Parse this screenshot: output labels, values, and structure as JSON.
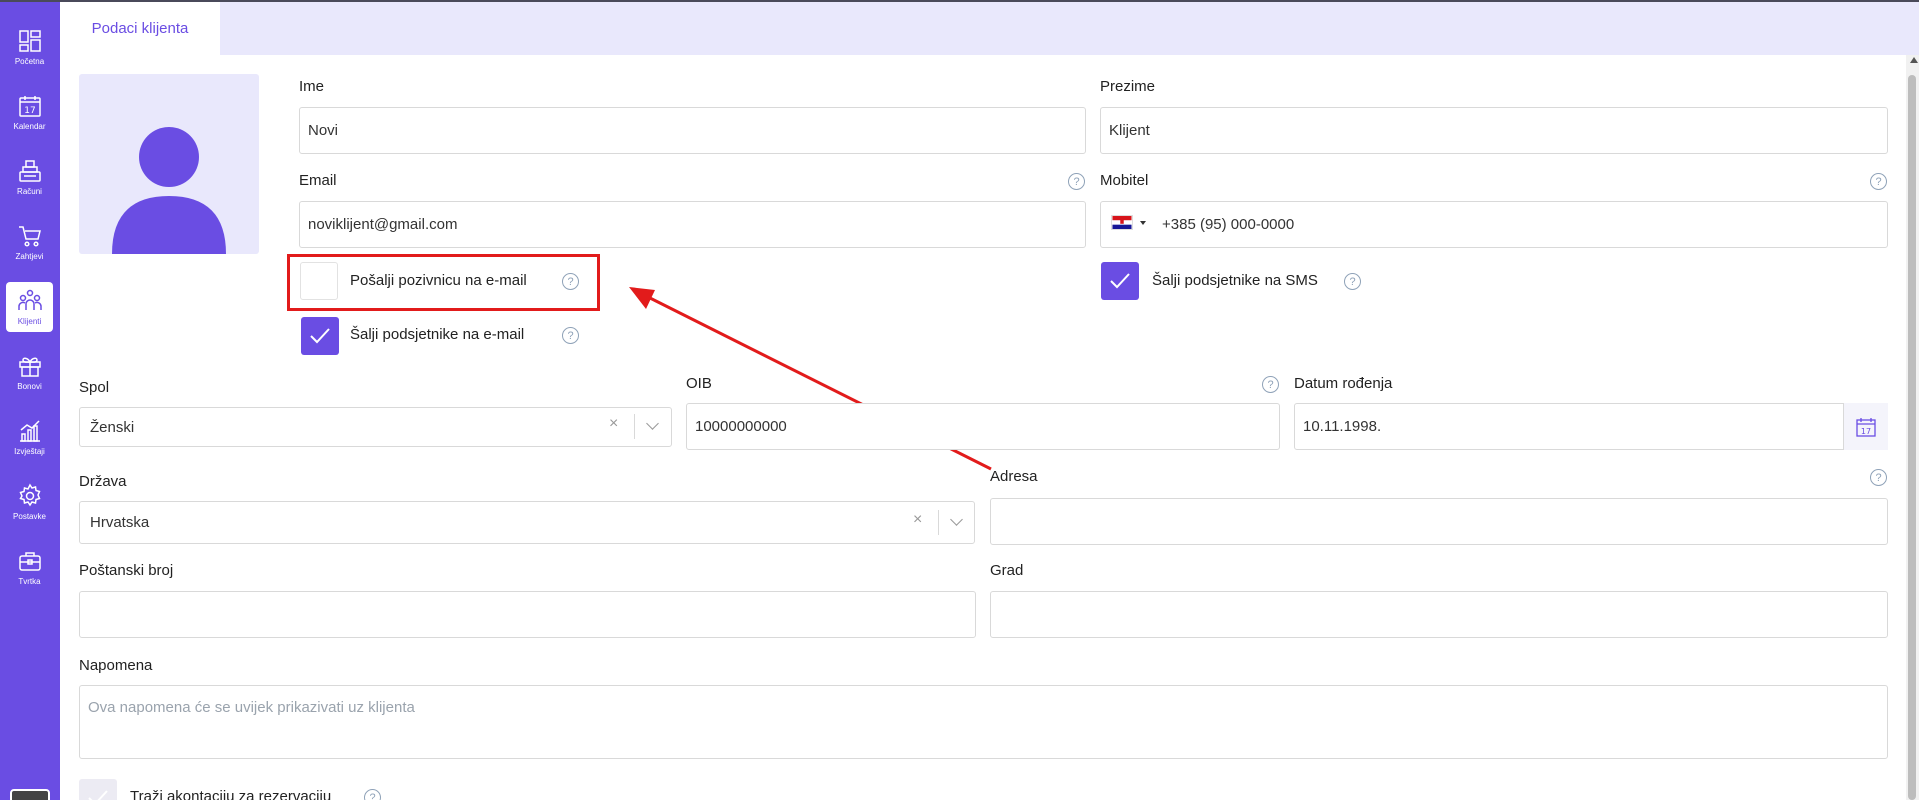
{
  "sidebar": {
    "items": [
      {
        "label": "Početna",
        "icon": "dashboard-icon"
      },
      {
        "label": "Kalendar",
        "icon": "calendar-icon"
      },
      {
        "label": "Računi",
        "icon": "cash-register-icon"
      },
      {
        "label": "Zahtjevi",
        "icon": "cart-icon"
      },
      {
        "label": "Klijenti",
        "icon": "clients-icon"
      },
      {
        "label": "Bonovi",
        "icon": "gift-icon"
      },
      {
        "label": "Izvještaji",
        "icon": "reports-icon"
      },
      {
        "label": "Postavke",
        "icon": "settings-icon"
      },
      {
        "label": "Tvrtka",
        "icon": "briefcase-icon"
      }
    ],
    "calendar_day": "17"
  },
  "tab": {
    "label": "Podaci klijenta"
  },
  "form": {
    "ime": {
      "label": "Ime",
      "value": "Novi"
    },
    "prezime": {
      "label": "Prezime",
      "value": "Klijent"
    },
    "email": {
      "label": "Email",
      "value": "noviklijent@gmail.com"
    },
    "mobitel": {
      "label": "Mobitel",
      "value": "+385 (95) 000-0000",
      "country": "HR"
    },
    "posalji_pozivnicu": {
      "label": "Pošalji pozivnicu na e-mail",
      "checked": false
    },
    "salji_email": {
      "label": "Šalji podsjetnike na e-mail",
      "checked": true
    },
    "salji_sms": {
      "label": "Šalji podsjetnike na SMS",
      "checked": true
    },
    "spol": {
      "label": "Spol",
      "value": "Ženski"
    },
    "oib": {
      "label": "OIB",
      "value": "10000000000"
    },
    "datum": {
      "label": "Datum rođenja",
      "value": "10.11.1998.",
      "calendar_day": "17"
    },
    "drzava": {
      "label": "Država",
      "value": "Hrvatska"
    },
    "adresa": {
      "label": "Adresa",
      "value": ""
    },
    "postanski": {
      "label": "Poštanski broj",
      "value": ""
    },
    "grad": {
      "label": "Grad",
      "value": ""
    },
    "napomena": {
      "label": "Napomena",
      "placeholder": "Ova napomena će se uvijek prikazivati uz klijenta"
    },
    "akontacija": {
      "label": "Traži akontaciju za rezervaciju",
      "checked": true
    }
  },
  "help_symbol": "?",
  "clear_symbol": "×",
  "colors": {
    "accent": "#6a4de3",
    "annotation": "#e21b1b",
    "tab_bar": "#e9e8fc"
  }
}
